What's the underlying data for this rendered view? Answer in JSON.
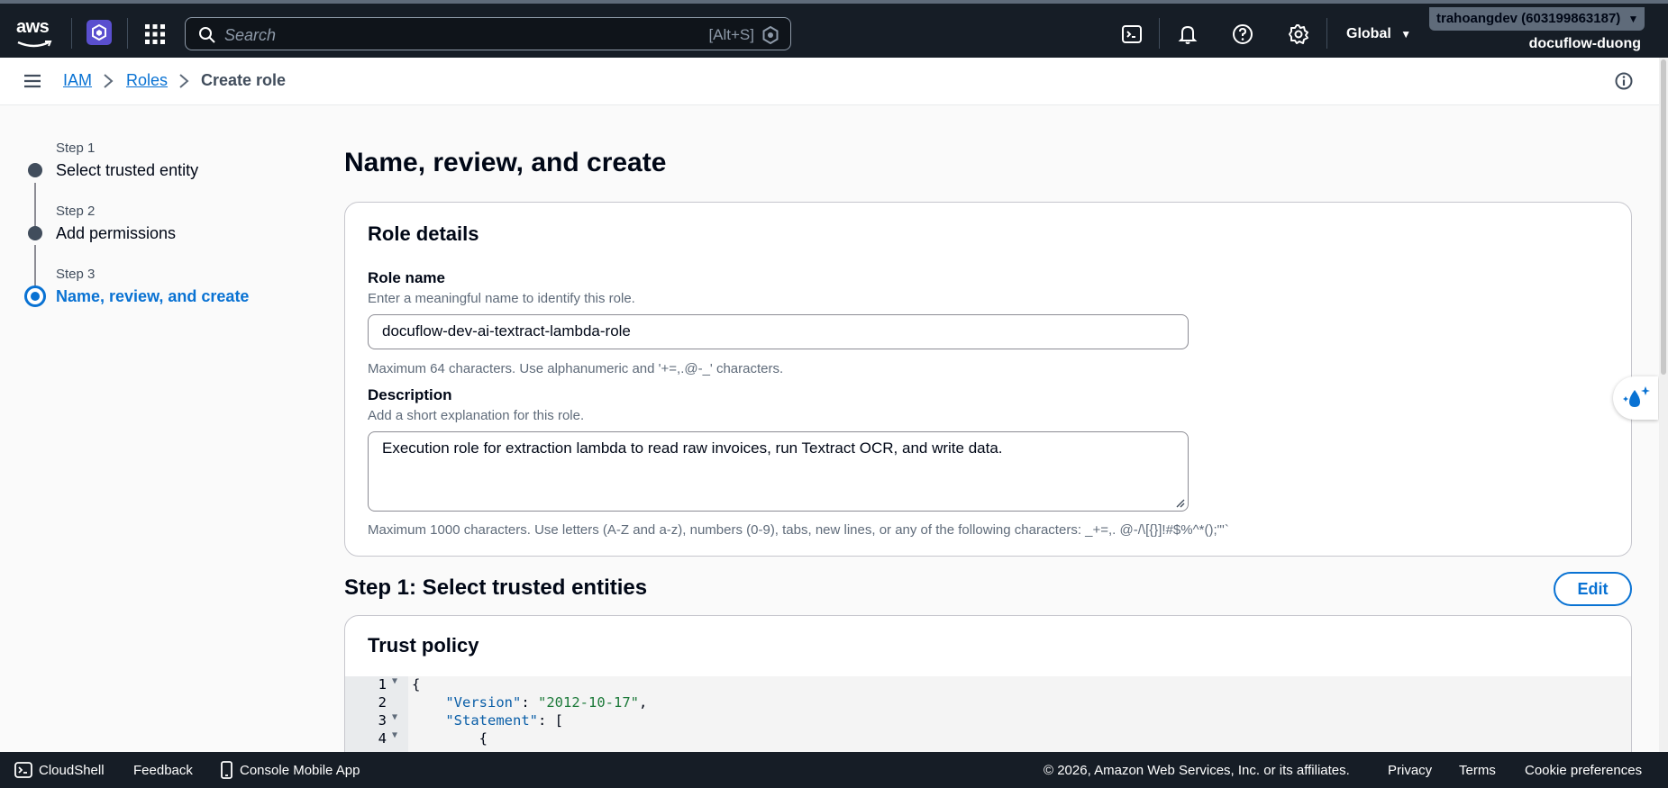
{
  "topnav": {
    "logo_text": "aws",
    "search_placeholder": "Search",
    "search_shortcut": "[Alt+S]",
    "region": "Global",
    "account": "trahoangdev (603199863187)",
    "organization": "docuflow-duong"
  },
  "breadcrumb": {
    "items": [
      "IAM",
      "Roles"
    ],
    "current": "Create role"
  },
  "wizard": {
    "steps": [
      {
        "number": "Step 1",
        "title": "Select trusted entity"
      },
      {
        "number": "Step 2",
        "title": "Add permissions"
      },
      {
        "number": "Step 3",
        "title": "Name, review, and create"
      }
    ],
    "active_step": 3
  },
  "page_title": "Name, review, and create",
  "role_details": {
    "heading": "Role details",
    "role_name_label": "Role name",
    "role_name_hint": "Enter a meaningful name to identify this role.",
    "role_name_value": "docuflow-dev-ai-textract-lambda-role",
    "role_name_constraint": "Maximum 64 characters. Use alphanumeric and '+=,.@-_' characters.",
    "description_label": "Description",
    "description_hint": "Add a short explanation for this role.",
    "description_value": "Execution role for extraction lambda to read raw invoices, run Textract OCR, and write data.",
    "description_constraint": "Maximum 1000 characters. Use letters (A-Z and a-z), numbers (0-9), tabs, new lines, or any of the following characters: _+=,. @-/\\[{}]!#$%^*();\"'`"
  },
  "step1_section": {
    "heading": "Step 1: Select trusted entities",
    "edit_label": "Edit",
    "trust_policy_heading": "Trust policy",
    "code_lines": [
      {
        "n": "1",
        "fold": true,
        "text": "{"
      },
      {
        "n": "2",
        "fold": false,
        "key": "\"Version\"",
        "sep": ": ",
        "val": "\"2012-10-17\"",
        "tail": ","
      },
      {
        "n": "3",
        "fold": true,
        "key": "\"Statement\"",
        "sep": ": [",
        "val": "",
        "tail": ""
      },
      {
        "n": "4",
        "fold": true,
        "text": "        {"
      }
    ]
  },
  "footer": {
    "cloudshell": "CloudShell",
    "feedback": "Feedback",
    "mobile_app": "Console Mobile App",
    "copyright": "© 2026, Amazon Web Services, Inc. or its affiliates.",
    "privacy": "Privacy",
    "terms": "Terms",
    "cookies": "Cookie preferences"
  },
  "colors": {
    "nav_bg": "#161d26",
    "link": "#0972d3",
    "text": "#000716"
  }
}
